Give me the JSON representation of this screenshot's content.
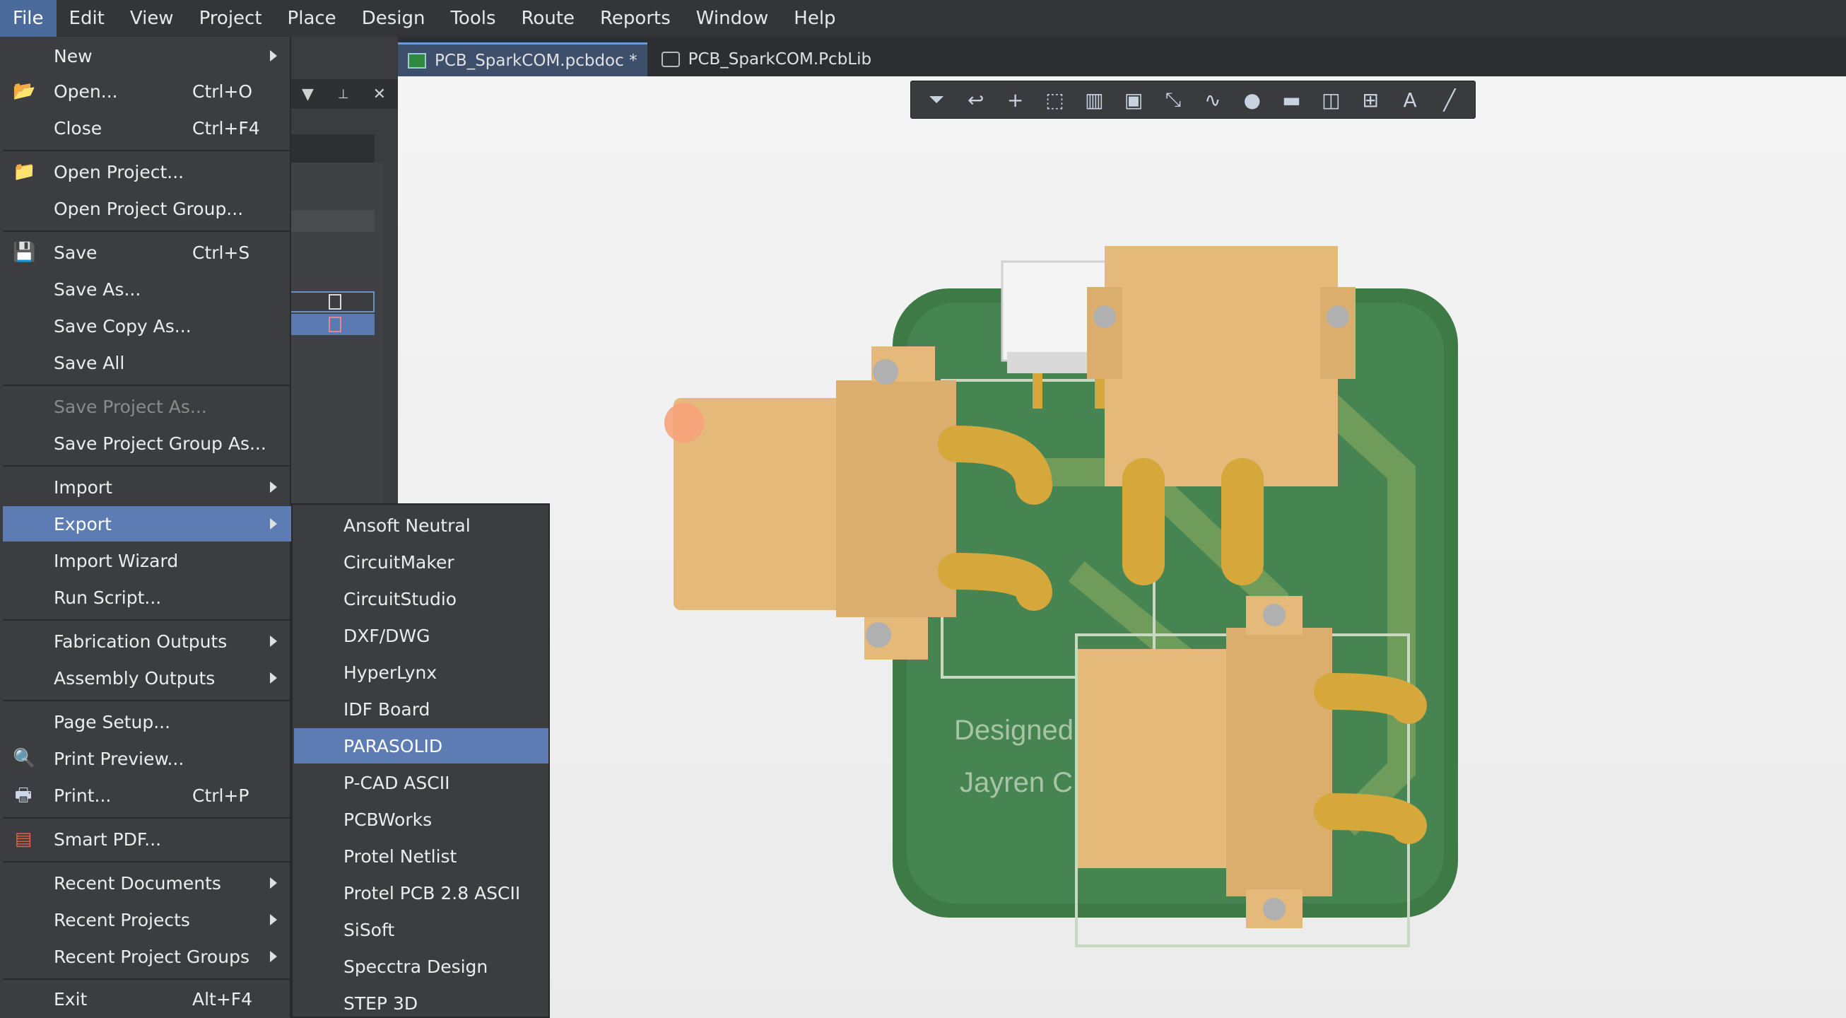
{
  "menubar": {
    "items": [
      "File",
      "Edit",
      "View",
      "Project",
      "Place",
      "Design",
      "Tools",
      "Route",
      "Reports",
      "Window",
      "Help"
    ]
  },
  "tabs": [
    {
      "label": "PCB_SparkCOM.pcbdoc *",
      "icon": "pcb-doc-icon"
    },
    {
      "label": "PCB_SparkCOM.PcbLib",
      "icon": "pcblib-icon"
    }
  ],
  "panel": {
    "dropdown_glyph": "▼",
    "pin_glyph": "📌",
    "close_glyph": "✕"
  },
  "file_menu": {
    "new": "New",
    "open": "Open...",
    "open_shortcut": "Ctrl+O",
    "close": "Close",
    "close_shortcut": "Ctrl+F4",
    "open_project": "Open Project...",
    "open_project_group": "Open Project Group...",
    "save": "Save",
    "save_shortcut": "Ctrl+S",
    "save_as": "Save As...",
    "save_copy_as": "Save Copy As...",
    "save_all": "Save All",
    "save_project_as": "Save Project As...",
    "save_project_group_as": "Save Project Group As...",
    "import": "Import",
    "export": "Export",
    "import_wizard": "Import Wizard",
    "run_script": "Run Script...",
    "fabrication_outputs": "Fabrication Outputs",
    "assembly_outputs": "Assembly Outputs",
    "page_setup": "Page Setup...",
    "print_preview": "Print Preview...",
    "print": "Print...",
    "print_shortcut": "Ctrl+P",
    "smart_pdf": "Smart PDF...",
    "recent_documents": "Recent Documents",
    "recent_projects": "Recent Projects",
    "recent_project_groups": "Recent Project Groups",
    "exit": "Exit",
    "exit_shortcut": "Alt+F4"
  },
  "export_submenu": {
    "items": [
      "Ansoft Neutral",
      "CircuitMaker",
      "CircuitStudio",
      "DXF/DWG",
      "HyperLynx",
      "IDF Board",
      "PARASOLID",
      "P-CAD ASCII",
      "PCBWorks",
      "Protel Netlist",
      "Protel PCB 2.8 ASCII",
      "SiSoft",
      "Specctra Design",
      "STEP 3D"
    ],
    "highlighted": "PARASOLID"
  },
  "board": {
    "silkscreen_line1": "Designed",
    "silkscreen_line2": "Jayren C",
    "colors": {
      "board": "#3d7a45",
      "component": "#e5b97a",
      "pin": "#d6a73a",
      "trace": "#6a9a55"
    }
  },
  "toolbar": {
    "icons": [
      "filter-icon",
      "route-icon",
      "add-icon",
      "select-rect-icon",
      "align-icon",
      "component-icon",
      "interactive-route-icon",
      "diff-pair-icon",
      "via-icon",
      "fill-icon",
      "region-icon",
      "dimension-icon",
      "text-icon",
      "line-icon"
    ]
  },
  "colors": {
    "accent": "#5c7cb3",
    "menu_bg": "#3c3d40",
    "menubar_bg": "#333538"
  }
}
